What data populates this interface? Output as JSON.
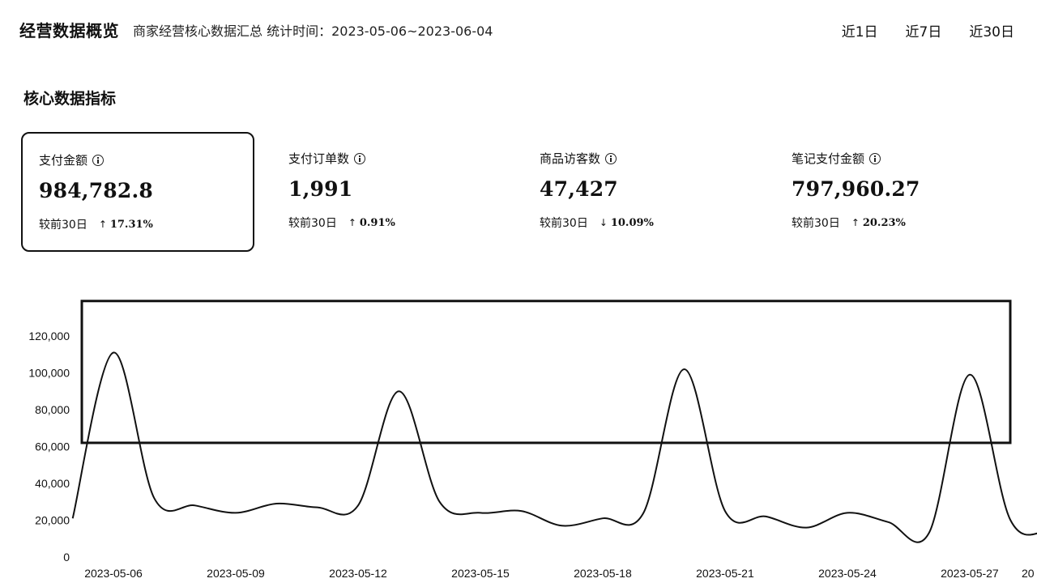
{
  "header": {
    "title": "经营数据概览",
    "subtitle": "商家经营核心数据汇总  统计时间：2023-05-06~2023-06-04",
    "range_tabs": [
      "近1日",
      "近7日",
      "近30日"
    ]
  },
  "section_title": "核心数据指标",
  "kpis": [
    {
      "label": "支付金额",
      "value": "984,782.8",
      "compare_label": "较前30日",
      "direction": "up",
      "change": "17.31%",
      "selected": true
    },
    {
      "label": "支付订单数",
      "value": "1,991",
      "compare_label": "较前30日",
      "direction": "up",
      "change": "0.91%",
      "selected": false
    },
    {
      "label": "商品访客数",
      "value": "47,427",
      "compare_label": "较前30日",
      "direction": "down",
      "change": "10.09%",
      "selected": false
    },
    {
      "label": "笔记支付金额",
      "value": "797,960.27",
      "compare_label": "较前30日",
      "direction": "up",
      "change": "20.23%",
      "selected": false
    }
  ],
  "icons": {
    "info": "info-circle-icon",
    "up": "arrow-up-icon",
    "down": "arrow-down-icon"
  },
  "chart_data": {
    "type": "line",
    "title": "",
    "xlabel": "",
    "ylabel": "",
    "ylim": [
      0,
      130000
    ],
    "yticks": [
      0,
      20000,
      40000,
      60000,
      80000,
      100000,
      120000
    ],
    "ytick_labels": [
      "0",
      "20,000",
      "40,000",
      "60,000",
      "80,000",
      "100,000",
      "120,000"
    ],
    "x_tick_labels": [
      "2023-05-06",
      "2023-05-09",
      "2023-05-12",
      "2023-05-15",
      "2023-05-18",
      "2023-05-21",
      "2023-05-24",
      "2023-05-27",
      "20"
    ],
    "grid": false,
    "highlight_range": [
      62000,
      139000
    ],
    "series": [
      {
        "x": [
          "2023-05-05",
          "2023-05-06",
          "2023-05-07",
          "2023-05-08",
          "2023-05-09",
          "2023-05-10",
          "2023-05-11",
          "2023-05-12",
          "2023-05-13",
          "2023-05-14",
          "2023-05-15",
          "2023-05-16",
          "2023-05-17",
          "2023-05-18",
          "2023-05-19",
          "2023-05-20",
          "2023-05-21",
          "2023-05-22",
          "2023-05-23",
          "2023-05-24",
          "2023-05-25",
          "2023-05-26",
          "2023-05-27",
          "2023-05-28",
          "2023-05-29",
          "2023-05-30"
        ],
        "values": [
          21000,
          111000,
          32000,
          28000,
          24000,
          29000,
          27000,
          28000,
          90000,
          30000,
          24000,
          25000,
          17000,
          21000,
          24000,
          102000,
          25000,
          22000,
          16000,
          24000,
          19000,
          13000,
          99000,
          20000,
          14000,
          13000
        ]
      }
    ]
  }
}
